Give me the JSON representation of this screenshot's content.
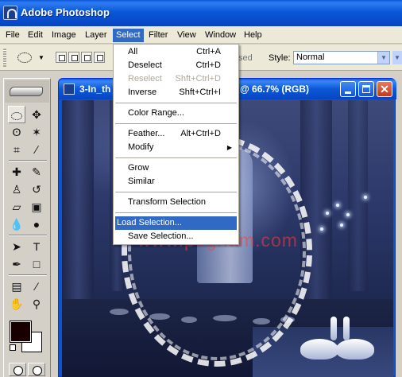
{
  "app": {
    "title": "Adobe Photoshop"
  },
  "menubar": {
    "items": [
      "File",
      "Edit",
      "Image",
      "Layer",
      "Select",
      "Filter",
      "View",
      "Window",
      "Help"
    ]
  },
  "options": {
    "feather_tail": "sed",
    "style_label": "Style:",
    "style_value": "Normal"
  },
  "document": {
    "name": "3-In_th",
    "zoom": "@ 66.7% (RGB)",
    "watermark": "www.pegham.com"
  },
  "select_menu": {
    "items": [
      {
        "label": "All",
        "shortcut": "Ctrl+A"
      },
      {
        "label": "Deselect",
        "shortcut": "Ctrl+D"
      },
      {
        "label": "Reselect",
        "shortcut": "Shft+Ctrl+D"
      },
      {
        "label": "Inverse",
        "shortcut": "Shft+Ctrl+I"
      },
      {
        "label": "Color Range..."
      },
      {
        "label": "Feather...",
        "shortcut": "Alt+Ctrl+D"
      },
      {
        "label": "Modify"
      },
      {
        "label": "Grow"
      },
      {
        "label": "Similar"
      },
      {
        "label": "Transform Selection"
      },
      {
        "label": "Load Selection..."
      },
      {
        "label": "Save Selection..."
      }
    ]
  },
  "colors": {
    "menu_highlight": "#316ac5",
    "foreground_color": "#180000",
    "background_color": "#ffffff"
  }
}
